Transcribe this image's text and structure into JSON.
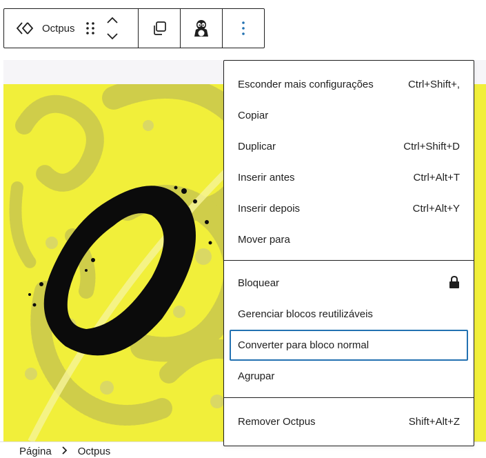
{
  "toolbar": {
    "block_name": "Octpus",
    "block_icon": "code-brackets-icon",
    "accent_color": "#2271b1"
  },
  "menu": {
    "groups": [
      [
        {
          "label": "Esconder mais configurações",
          "shortcut": "Ctrl+Shift+,"
        },
        {
          "label": "Copiar",
          "shortcut": ""
        },
        {
          "label": "Duplicar",
          "shortcut": "Ctrl+Shift+D"
        },
        {
          "label": "Inserir antes",
          "shortcut": "Ctrl+Alt+T"
        },
        {
          "label": "Inserir depois",
          "shortcut": "Ctrl+Alt+Y"
        },
        {
          "label": "Mover para",
          "shortcut": ""
        }
      ],
      [
        {
          "label": "Bloquear",
          "icon": "lock-icon"
        },
        {
          "label": "Gerenciar blocos reutilizáveis"
        },
        {
          "label": "Converter para bloco normal",
          "focused": true
        },
        {
          "label": "Agrupar"
        }
      ],
      [
        {
          "label": "Remover Octpus",
          "shortcut": "Shift+Alt+Z"
        }
      ]
    ]
  },
  "breadcrumb": {
    "items": [
      "Página",
      "Octpus"
    ]
  },
  "colors": {
    "artwork_background": "#f1ef3a",
    "canvas_strip": "#f6f5f8",
    "text": "#1e1e1e"
  }
}
